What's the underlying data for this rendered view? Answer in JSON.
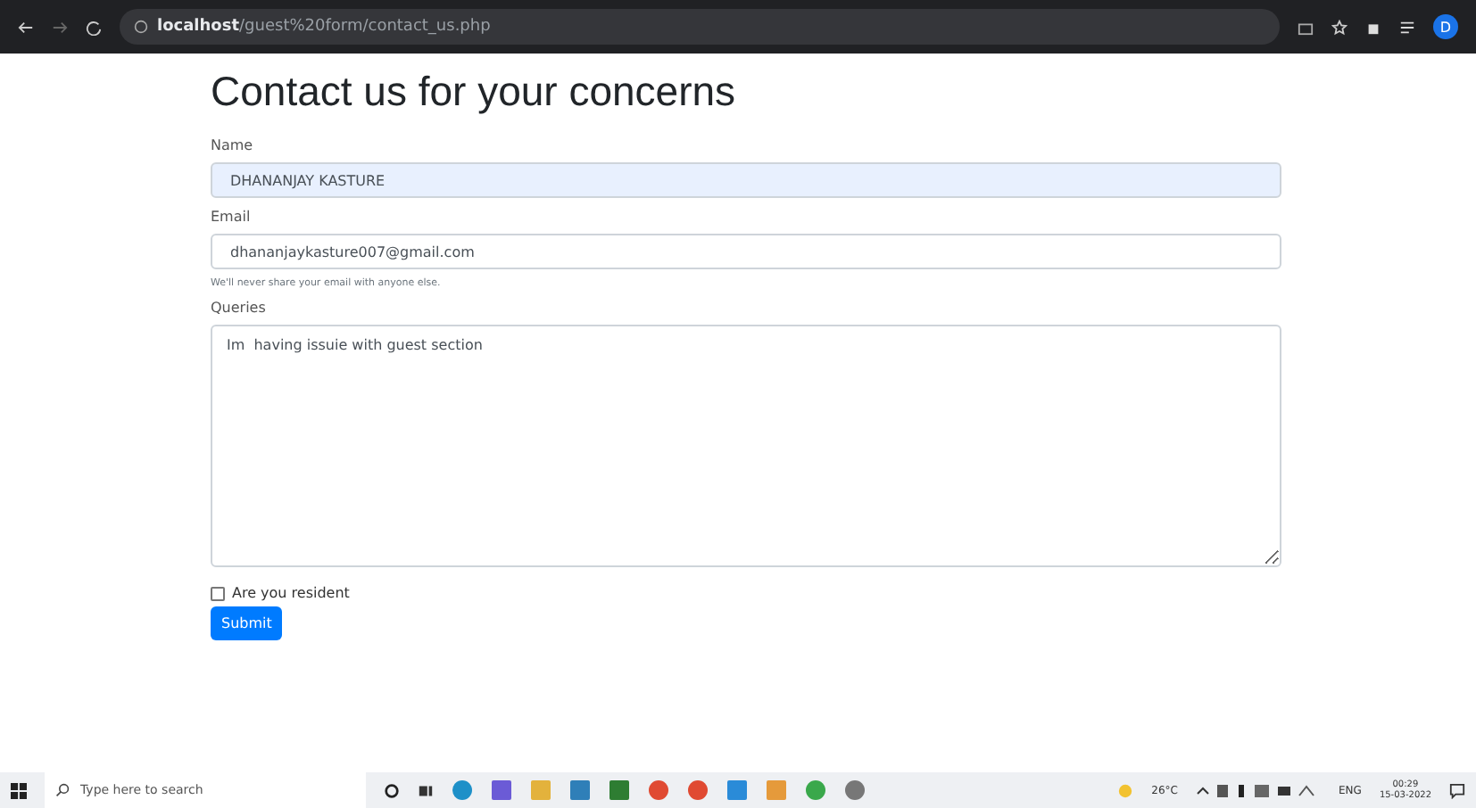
{
  "browser": {
    "url_host": "localhost",
    "url_path": "/guest%20form/contact_us.php",
    "profile_initial": "D"
  },
  "form": {
    "title": "Contact us for your concerns",
    "name": {
      "label": "Name",
      "value": "DHANANJAY KASTURE",
      "autofilled": true
    },
    "email": {
      "label": "Email",
      "value": "dhananjaykasture007@gmail.com",
      "help": "We'll never share your email with anyone else."
    },
    "queries": {
      "label": "Queries",
      "value": "Im  having issuie with guest section"
    },
    "resident": {
      "label": "Are you resident",
      "checked": false
    },
    "submit": "Submit"
  },
  "taskbar": {
    "search_placeholder": "Type here to search",
    "temperature": "26°C",
    "language": "ENG",
    "time": "00:29",
    "date": "15-03-2022"
  }
}
